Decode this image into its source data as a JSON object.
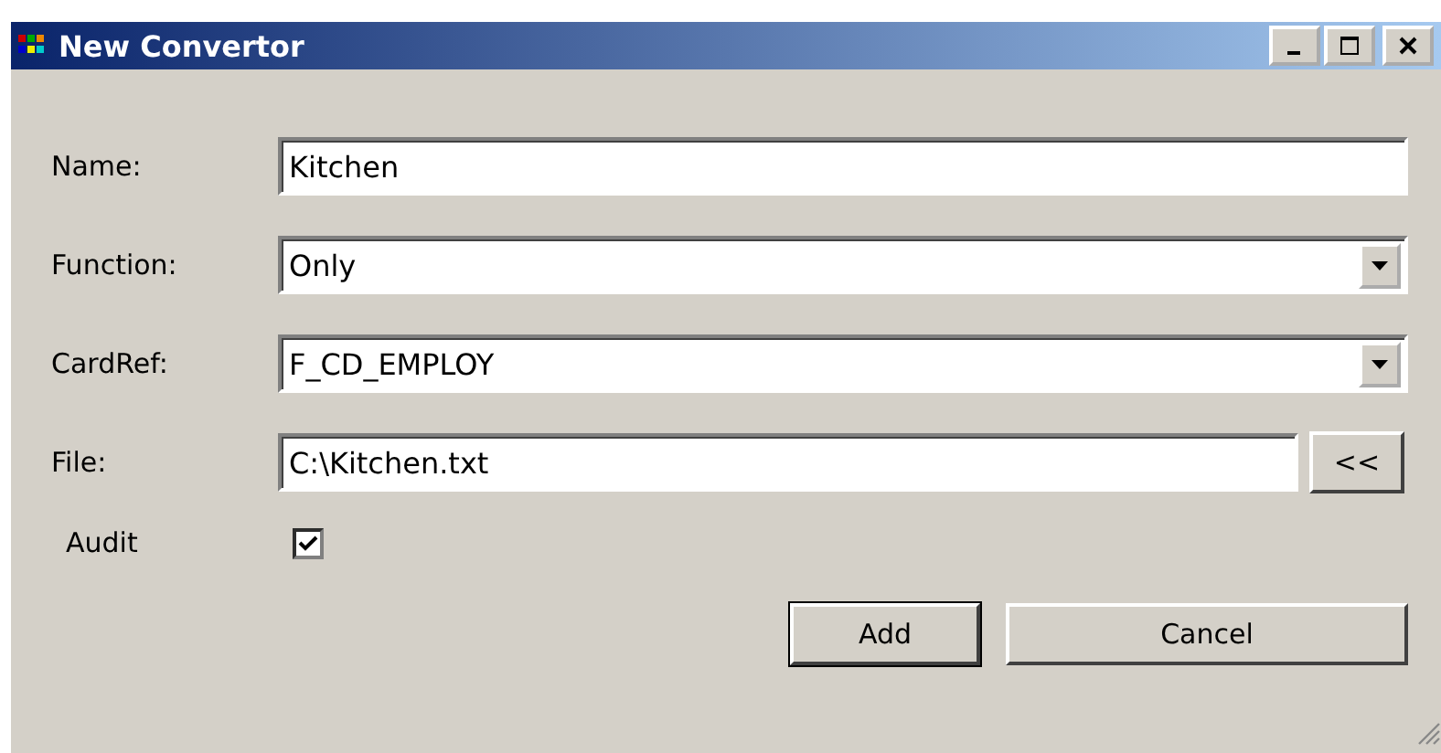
{
  "window": {
    "title": "New Convertor"
  },
  "fields": [
    {
      "kind": "text",
      "label": "Name:",
      "value": "Kitchen"
    },
    {
      "kind": "dropdown",
      "label": "Function:",
      "value": "Only"
    },
    {
      "kind": "dropdown",
      "label": "CardRef:",
      "value": "F_CD_EMPLOY"
    },
    {
      "kind": "browse",
      "label": "File:",
      "value": "C:\\Kitchen.txt",
      "button": "<<"
    }
  ],
  "audit": {
    "label": "Audit",
    "checked": true
  },
  "buttons": [
    {
      "label": "Add",
      "default": true
    },
    {
      "label": "Cancel",
      "default": false
    }
  ]
}
